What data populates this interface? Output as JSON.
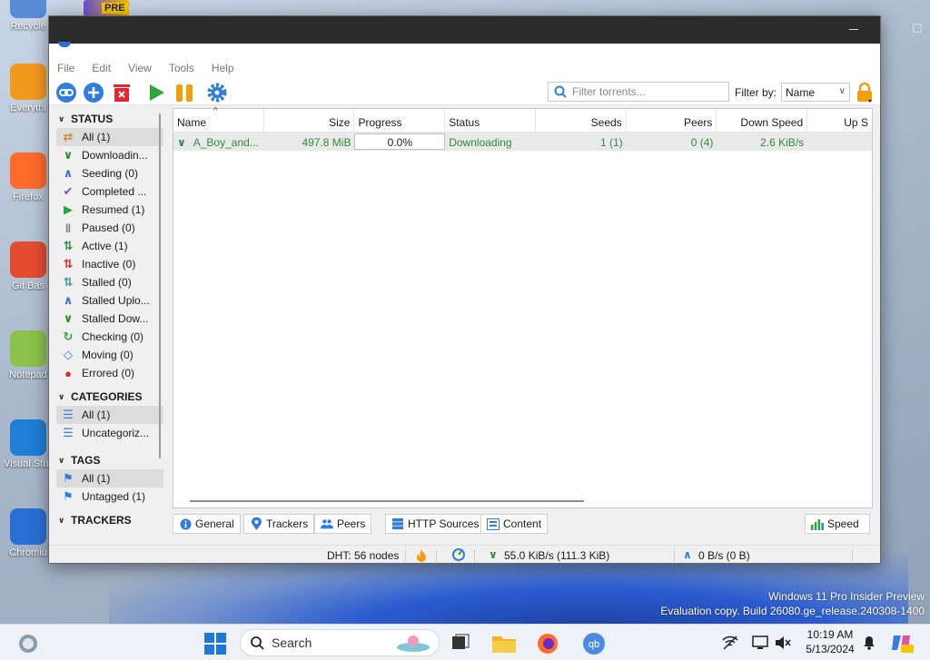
{
  "desktop": {
    "icons": [
      {
        "label": "Recycle",
        "color": "#5a8bd6"
      },
      {
        "label": "Everythi",
        "color": "#f39a1e"
      },
      {
        "label": "Firefox",
        "color": "#ff6b2b"
      },
      {
        "label": "Git Bas",
        "color": "#e44c30"
      },
      {
        "label": "Notepad",
        "color": "#8ac24a"
      },
      {
        "label": "Visual Stu Code",
        "color": "#1f7fd6"
      },
      {
        "label": "Chromiu",
        "color": "#2a6fd6"
      }
    ],
    "pre_badge": "PRE"
  },
  "menu": [
    "File",
    "Edit",
    "View",
    "Tools",
    "Help"
  ],
  "toolbar": {
    "filter_placeholder": "Filter torrents...",
    "filter_by_label": "Filter by:",
    "filter_by_value": "Name",
    "colors": {
      "blue": "#2f7ddf",
      "red": "#e3262f",
      "green": "#2aa837",
      "orange": "#f29d0c"
    }
  },
  "sidebar": {
    "status_header": "STATUS",
    "status_items": [
      {
        "label": "All (1)",
        "icon": "shuffle-icon",
        "color": "#c8902a"
      },
      {
        "label": "Downloadin...",
        "icon": "download-icon",
        "color": "#2f8a3a"
      },
      {
        "label": "Seeding (0)",
        "icon": "upload-icon",
        "color": "#3a6fd0"
      },
      {
        "label": "Completed ...",
        "icon": "check-icon",
        "color": "#7c4bc8"
      },
      {
        "label": "Resumed (1)",
        "icon": "play-icon",
        "color": "#2aa837"
      },
      {
        "label": "Paused (0)",
        "icon": "pause-icon",
        "color": "#777777"
      },
      {
        "label": "Active (1)",
        "icon": "updown-icon",
        "color": "#2f8a3a"
      },
      {
        "label": "Inactive (0)",
        "icon": "updown-red-icon",
        "color": "#d62e2e"
      },
      {
        "label": "Stalled (0)",
        "icon": "updown-stalled-icon",
        "color": "#3a9b9b"
      },
      {
        "label": "Stalled Uplo...",
        "icon": "upload-stalled-icon",
        "color": "#3a6fd0"
      },
      {
        "label": "Stalled Dow...",
        "icon": "download-stalled-icon",
        "color": "#2f8a3a"
      },
      {
        "label": "Checking (0)",
        "icon": "refresh-icon",
        "color": "#2aa837"
      },
      {
        "label": "Moving (0)",
        "icon": "move-icon",
        "color": "#2f7ddf"
      },
      {
        "label": "Errored (0)",
        "icon": "error-icon",
        "color": "#d62e2e"
      }
    ],
    "categories_header": "CATEGORIES",
    "category_items": [
      {
        "label": "All (1)"
      },
      {
        "label": "Uncategoriz..."
      }
    ],
    "tags_header": "TAGS",
    "tag_items": [
      {
        "label": "All (1)"
      },
      {
        "label": "Untagged (1)"
      }
    ],
    "trackers_header": "TRACKERS"
  },
  "table": {
    "columns": [
      "Name",
      "Size",
      "Progress",
      "Status",
      "Seeds",
      "Peers",
      "Down Speed",
      "Up S"
    ],
    "rows": [
      {
        "name": "A_Boy_and...",
        "size": "497.8 MiB",
        "progress": "0.0%",
        "status": "Downloading",
        "seeds": "1 (1)",
        "peers": "0 (4)",
        "down_speed": "2.6 KiB/s"
      }
    ]
  },
  "tabs": [
    "General",
    "Trackers",
    "Peers",
    "HTTP Sources",
    "Content"
  ],
  "speed_button": "Speed",
  "statusbar": {
    "dht": "DHT: 56 nodes",
    "download": "55.0 KiB/s (111.3 KiB)",
    "upload": "0 B/s (0 B)"
  },
  "watermark": {
    "line1": "Windows 11 Pro Insider Preview",
    "line2": "Evaluation copy. Build 26080.ge_release.240308-1400"
  },
  "taskbar": {
    "search_label": "Search",
    "time": "10:19 AM",
    "date": "5/13/2024"
  }
}
